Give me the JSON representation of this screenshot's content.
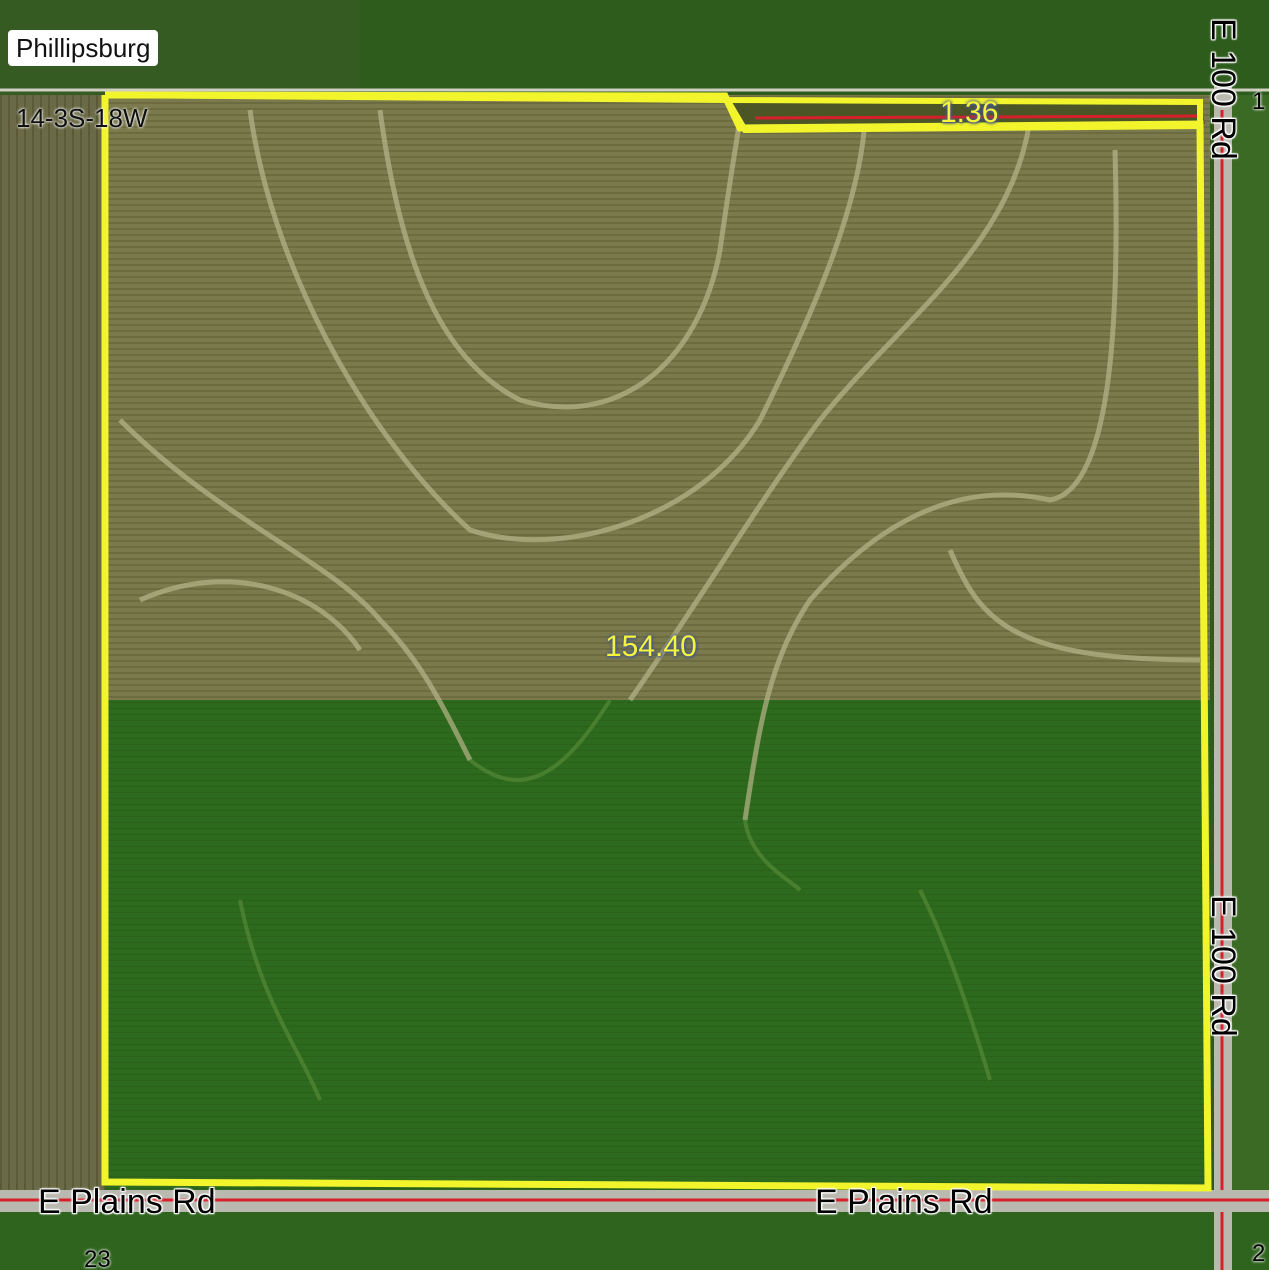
{
  "map": {
    "town_label": "Phillipsburg",
    "section_label": "14-3S-18W",
    "roads": {
      "east_top": "E 100 Rd",
      "east_bottom": "E 100 Rd",
      "south_left": "E Plains Rd",
      "south_right": "E Plains Rd"
    },
    "tracts": [
      {
        "acres": "154.40"
      },
      {
        "acres": "1.36"
      }
    ],
    "corner_numbers": {
      "bottom_left": "23",
      "bottom_right": "2",
      "top_right": "1"
    },
    "colors": {
      "boundary": "#f2f52b",
      "road_red": "#d8202a",
      "field_green": "#2f6a1f",
      "field_tan": "#7d7a4c"
    }
  }
}
